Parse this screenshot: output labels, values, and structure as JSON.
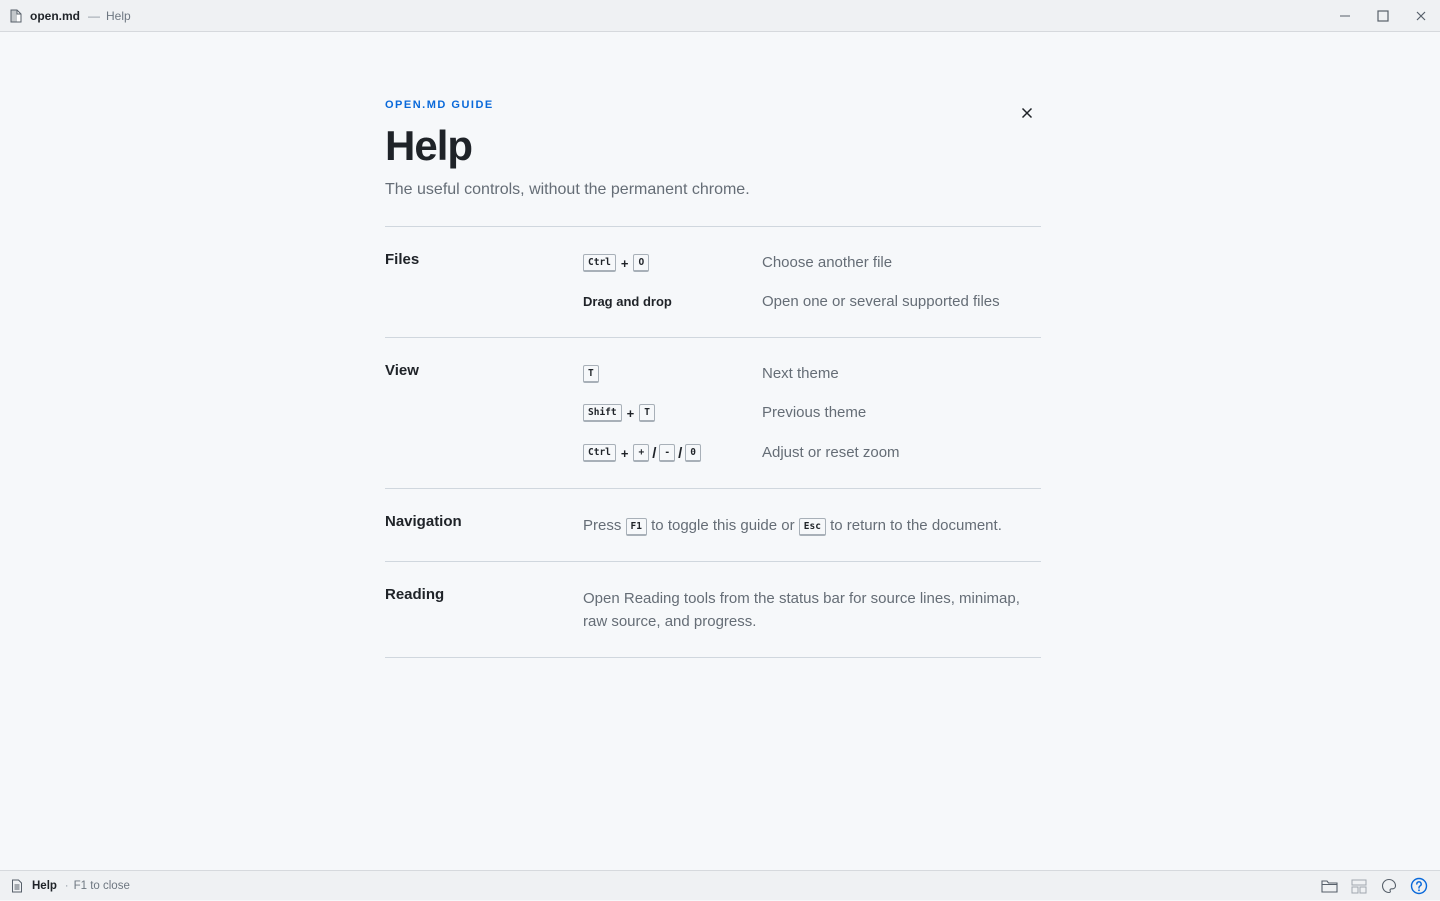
{
  "titlebar": {
    "file_name": "open.md",
    "separator": "—",
    "view_name": "Help"
  },
  "header": {
    "eyebrow": "OPEN.MD GUIDE",
    "title": "Help",
    "subtitle": "The useful controls, without the permanent chrome."
  },
  "sections": {
    "files": {
      "title": "Files",
      "rows": [
        {
          "keys": [
            "Ctrl",
            "O"
          ],
          "desc": "Choose another file"
        },
        {
          "label": "Drag and drop",
          "desc": "Open one or several supported files"
        }
      ]
    },
    "view": {
      "title": "View",
      "rows": [
        {
          "keys": [
            "T"
          ],
          "desc": "Next theme"
        },
        {
          "keys": [
            "Shift",
            "T"
          ],
          "desc": "Previous theme"
        },
        {
          "keys": [
            "Ctrl",
            "+",
            "-",
            "0"
          ],
          "desc": "Adjust or reset zoom"
        }
      ]
    },
    "navigation": {
      "title": "Navigation",
      "text_before": "Press",
      "key1": "F1",
      "text_middle": "to toggle this guide or",
      "key2": "Esc",
      "text_after": "to return to the document."
    },
    "reading": {
      "title": "Reading",
      "text": "Open Reading tools from the status bar for source lines, minimap, raw source, and progress."
    }
  },
  "symbols": {
    "plus": "+",
    "slash": "/"
  },
  "statusbar": {
    "label": "Help",
    "dot": "·",
    "hint": "F1 to close"
  },
  "colors": {
    "accent": "#0969da",
    "background": "#f6f8fa",
    "chrome": "#eff1f3"
  },
  "icons": {
    "titlebar": "document-icon",
    "window": [
      "minimize-icon",
      "maximize-icon",
      "close-icon"
    ],
    "status": [
      "folder-icon",
      "layout-icon",
      "palette-icon",
      "help-icon"
    ]
  }
}
